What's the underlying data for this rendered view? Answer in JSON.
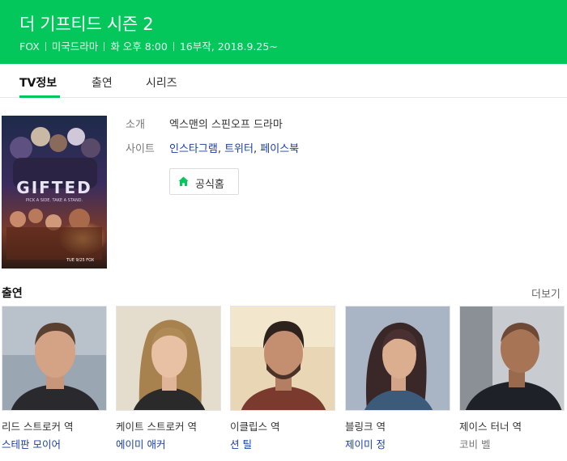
{
  "header": {
    "title": "더 기프티드 시즌 2",
    "meta": [
      "FOX",
      "미국드라마",
      "화 오후 8:00",
      "16부작, 2018.9.25~"
    ]
  },
  "tabs": [
    "TV정보",
    "출연",
    "시리즈"
  ],
  "poster": {
    "logo_text": "GIFTED",
    "tagline": "PICK A SIDE. TAKE A STAND.",
    "badge": "TUE 9/25 FOX"
  },
  "info": {
    "intro_label": "소개",
    "intro_value": "엑스맨의 스핀오프 드라마",
    "site_label": "사이트",
    "sites": [
      "인스타그램",
      "트위터",
      "페이스북"
    ],
    "home_button": "공식홈",
    "home_icon": "house-icon"
  },
  "cast": {
    "title": "출연",
    "more": "더보기",
    "members": [
      {
        "role": "리드 스트로커 역",
        "actor": "스테판 모이어"
      },
      {
        "role": "케이트 스트로커 역",
        "actor": "에이미 애커"
      },
      {
        "role": "이클립스 역",
        "actor": "션 틸"
      },
      {
        "role": "블링크 역",
        "actor": "제이미 정"
      },
      {
        "role": "제이스 터너 역",
        "actor": "코비 벨"
      }
    ]
  },
  "colors": {
    "brand": "#03c75a",
    "link": "#1a3fa8"
  }
}
